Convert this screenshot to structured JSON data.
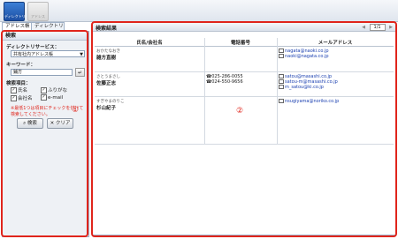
{
  "toolbar": {
    "active_button_label": "ディレクトリ",
    "second_button_label": "アドレス"
  },
  "tabs": [
    {
      "label": "アドレス帳"
    },
    {
      "label": "ディレクトリ"
    }
  ],
  "search_panel": {
    "title": "検索",
    "directory_service_label": "ディレクトリサービス：",
    "directory_service_value": "共有社内アドレス帳",
    "keyword_label": "キーワード：",
    "keyword_value": "鋪方",
    "search_items_label": "検索項目：",
    "checkboxes": [
      {
        "label": "氏名",
        "checked": true
      },
      {
        "label": "ふりがな",
        "checked": true
      },
      {
        "label": "会社名",
        "checked": true
      },
      {
        "label": "e-mail",
        "checked": true
      }
    ],
    "note": "※最低1つは項目にチェックを付けて検索してください。",
    "search_button": "検索",
    "clear_button": "クリア",
    "marker": "①"
  },
  "results": {
    "title": "検索結果",
    "pager": {
      "value": "1/1"
    },
    "columns": [
      "氏名/会社名",
      "電話番号",
      "メールアドレス"
    ],
    "rows": [
      {
        "kana": "おかたなおき",
        "name": "雑方直樹",
        "phones": [],
        "emails": [
          "nagata@naoki.co.jp",
          "naoki@nagata.co.jp"
        ]
      },
      {
        "kana": "さとうまさし",
        "name": "佐藤正志",
        "phones": [
          "025-286-0055",
          "024-550-9656"
        ],
        "emails": [
          "satou@masashi.co.jp",
          "satou-m@masashi.co.jp",
          "m_satou@ki.co.jp"
        ]
      },
      {
        "kana": "すぎやまのりこ",
        "name": "杉山紀子",
        "phones": [],
        "emails": [
          "nsugiyama@noriko.co.jp"
        ]
      }
    ],
    "marker": "②"
  },
  "colors": {
    "annotation": "#e0251c",
    "link": "#1a3fb0",
    "toolbar_active": "#1d4fa3"
  }
}
